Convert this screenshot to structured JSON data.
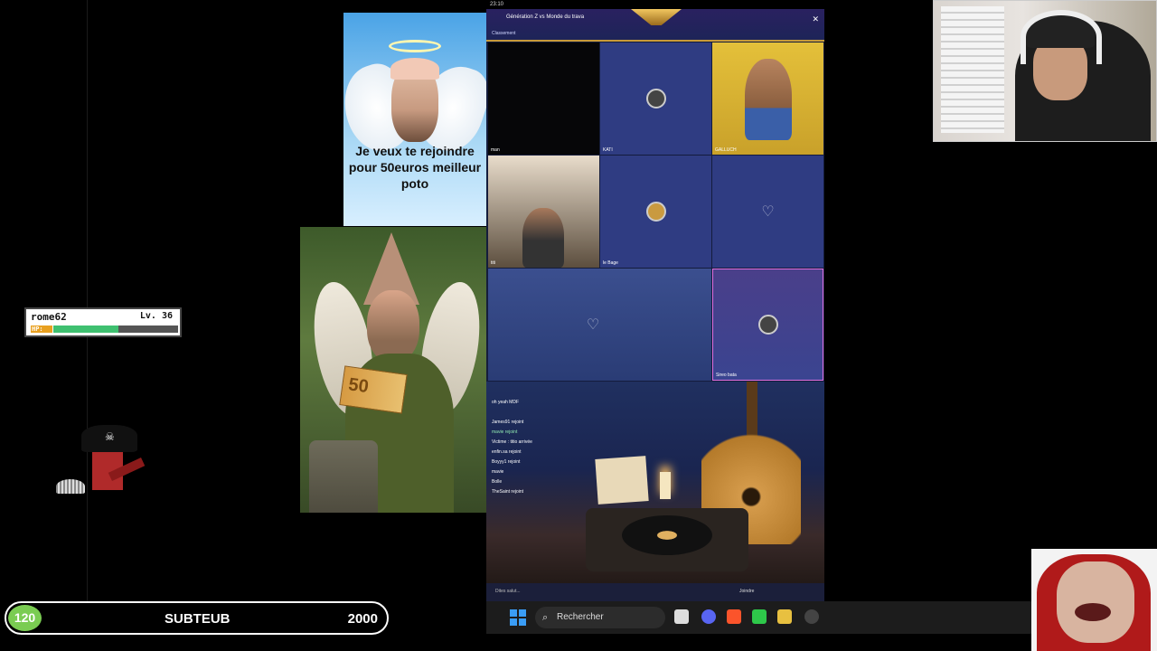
{
  "meme_top": {
    "text": "Je veux te rejoindre pour 50euros meilleur poto"
  },
  "meme_elf": {
    "bill": "50"
  },
  "call": {
    "status_time": "23:10",
    "title": "Génération Z vs Monde du trava",
    "tab": "Classement",
    "tiles": [
      {
        "tag": "Hod",
        "label": "man",
        "style": "dark"
      },
      {
        "label": "KATI",
        "style": "blue-avatar"
      },
      {
        "label": "GALLUCH",
        "style": "yellow"
      },
      {
        "label": "titi",
        "style": "room"
      },
      {
        "label": "le Bage",
        "style": "blue-avatar"
      },
      {
        "label": "",
        "style": "blue-heart"
      },
      {
        "label": "",
        "style": "city-wide"
      },
      {
        "label": "Sireo bata",
        "style": "pink-avatar"
      }
    ],
    "chat": [
      "oh yeah MDF",
      "James91 rejoint",
      "mavie rejoint",
      "Victime : titio arrivée",
      "enfin.sa rejoint",
      "Boyyy1 rejoint",
      "mavie",
      "Bolle",
      "TheSaint rejoint"
    ],
    "input_placeholder": "Dites salut...",
    "join_label": "Joindre"
  },
  "hp_box": {
    "name": "rome62",
    "level": "Lv. 36",
    "hp_label": "HP:",
    "hp_fraction": 0.52
  },
  "sub_goal": {
    "count": "120",
    "label": "SUBTEUB",
    "goal": "2000"
  },
  "taskbar": {
    "search_placeholder": "Rechercher",
    "search_icon": "search-icon"
  }
}
